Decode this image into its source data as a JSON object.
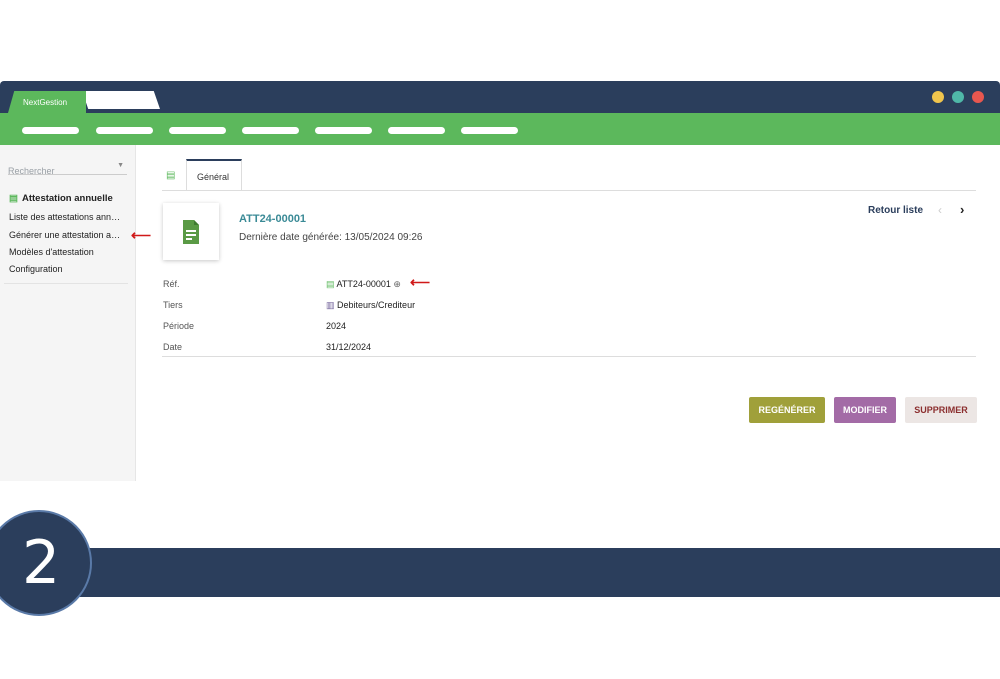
{
  "app": {
    "tab_label": "NextGestion",
    "window_dots": [
      "#f0c54d",
      "#4fb8a8",
      "#e8574f"
    ]
  },
  "sidebar": {
    "search_placeholder": "Rechercher",
    "heading": "Attestation annuelle",
    "items": [
      {
        "label": "Liste des attestations ann…"
      },
      {
        "label": "Générer une attestation a…"
      },
      {
        "label": "Modèles d'attestation"
      },
      {
        "label": "Configuration"
      }
    ]
  },
  "main": {
    "tab_label": "Général",
    "ref_title": "ATT24-00001",
    "subtitle": "Dernière date générée: 13/05/2024 09:26",
    "back_link": "Retour liste",
    "fields": [
      {
        "label": "Réf.",
        "value": "ATT24-00001"
      },
      {
        "label": "Tiers",
        "value": "Debiteurs/Crediteur"
      },
      {
        "label": "Période",
        "value": "2024"
      },
      {
        "label": "Date",
        "value": "31/12/2024"
      }
    ],
    "buttons": {
      "regen": "REGÉNÉRER",
      "modify": "MODIFIER",
      "delete": "SUPPRIMER"
    }
  },
  "step_number": "2",
  "colors": {
    "navy": "#2b3e5c",
    "green": "#5cb85c",
    "regen": "#a0a03a",
    "modify": "#a36ba6",
    "arrow": "#d01919"
  }
}
